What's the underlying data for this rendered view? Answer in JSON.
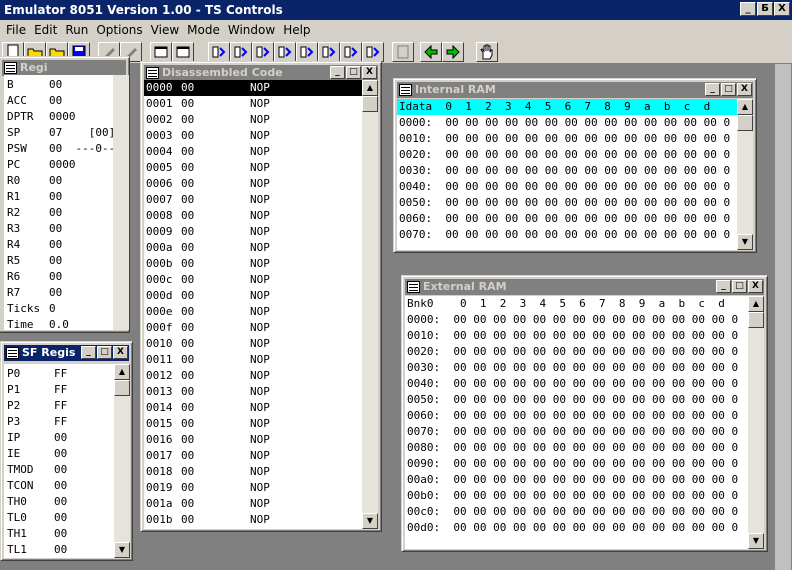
{
  "app": {
    "title": "Emulator 8051 Version 1.00 - TS Controls"
  },
  "menu": [
    "File",
    "Edit",
    "Run",
    "Options",
    "View",
    "Mode",
    "Window",
    "Help"
  ],
  "caption_buttons": [
    "_",
    "Б",
    "X"
  ],
  "toolbar_icons": [
    "new-file-icon",
    "open-folder-icon",
    "open-folder-icon",
    "save-icon",
    "tool-icon",
    "tool-icon",
    "window-icon",
    "window-icon",
    "step-icon",
    "step-icon",
    "step-icon",
    "step-icon",
    "step-icon",
    "step-icon",
    "step-icon",
    "step-icon",
    "disabled-icon",
    "back-arrow-icon",
    "forward-arrow-icon",
    "hand-icon"
  ],
  "registers": {
    "title": "Regi",
    "rows": [
      {
        "name": "B",
        "value": "00"
      },
      {
        "name": "ACC",
        "value": "00"
      },
      {
        "name": "DPTR",
        "value": "0000"
      },
      {
        "name": "SP",
        "value": "07    [00]"
      },
      {
        "name": "PSW",
        "value": "00  ---0--"
      },
      {
        "name": "PC",
        "value": "0000"
      },
      {
        "name": "R0",
        "value": "00"
      },
      {
        "name": "R1",
        "value": "00"
      },
      {
        "name": "R2",
        "value": "00"
      },
      {
        "name": "R3",
        "value": "00"
      },
      {
        "name": "R4",
        "value": "00"
      },
      {
        "name": "R5",
        "value": "00"
      },
      {
        "name": "R6",
        "value": "00"
      },
      {
        "name": "R7",
        "value": "00"
      },
      {
        "name": "Ticks",
        "value": "0"
      },
      {
        "name": "Time",
        "value": "0.0"
      }
    ]
  },
  "sfr": {
    "title": "SF Regis",
    "rows": [
      {
        "name": "P0",
        "value": "FF"
      },
      {
        "name": "P1",
        "value": "FF"
      },
      {
        "name": "P2",
        "value": "FF"
      },
      {
        "name": "P3",
        "value": "FF"
      },
      {
        "name": "IP",
        "value": "00"
      },
      {
        "name": "IE",
        "value": "00"
      },
      {
        "name": "TMOD",
        "value": "00"
      },
      {
        "name": "TCON",
        "value": "00"
      },
      {
        "name": "TH0",
        "value": "00"
      },
      {
        "name": "TL0",
        "value": "00"
      },
      {
        "name": "TH1",
        "value": "00"
      },
      {
        "name": "TL1",
        "value": "00"
      }
    ]
  },
  "disasm": {
    "title": "Disassembled Code",
    "rows": [
      {
        "addr": "0000",
        "byte": "00",
        "op": "NOP"
      },
      {
        "addr": "0001",
        "byte": "00",
        "op": "NOP"
      },
      {
        "addr": "0002",
        "byte": "00",
        "op": "NOP"
      },
      {
        "addr": "0003",
        "byte": "00",
        "op": "NOP"
      },
      {
        "addr": "0004",
        "byte": "00",
        "op": "NOP"
      },
      {
        "addr": "0005",
        "byte": "00",
        "op": "NOP"
      },
      {
        "addr": "0006",
        "byte": "00",
        "op": "NOP"
      },
      {
        "addr": "0007",
        "byte": "00",
        "op": "NOP"
      },
      {
        "addr": "0008",
        "byte": "00",
        "op": "NOP"
      },
      {
        "addr": "0009",
        "byte": "00",
        "op": "NOP"
      },
      {
        "addr": "000a",
        "byte": "00",
        "op": "NOP"
      },
      {
        "addr": "000b",
        "byte": "00",
        "op": "NOP"
      },
      {
        "addr": "000c",
        "byte": "00",
        "op": "NOP"
      },
      {
        "addr": "000d",
        "byte": "00",
        "op": "NOP"
      },
      {
        "addr": "000e",
        "byte": "00",
        "op": "NOP"
      },
      {
        "addr": "000f",
        "byte": "00",
        "op": "NOP"
      },
      {
        "addr": "0010",
        "byte": "00",
        "op": "NOP"
      },
      {
        "addr": "0011",
        "byte": "00",
        "op": "NOP"
      },
      {
        "addr": "0012",
        "byte": "00",
        "op": "NOP"
      },
      {
        "addr": "0013",
        "byte": "00",
        "op": "NOP"
      },
      {
        "addr": "0014",
        "byte": "00",
        "op": "NOP"
      },
      {
        "addr": "0015",
        "byte": "00",
        "op": "NOP"
      },
      {
        "addr": "0016",
        "byte": "00",
        "op": "NOP"
      },
      {
        "addr": "0017",
        "byte": "00",
        "op": "NOP"
      },
      {
        "addr": "0018",
        "byte": "00",
        "op": "NOP"
      },
      {
        "addr": "0019",
        "byte": "00",
        "op": "NOP"
      },
      {
        "addr": "001a",
        "byte": "00",
        "op": "NOP"
      },
      {
        "addr": "001b",
        "byte": "00",
        "op": "NOP"
      }
    ]
  },
  "iram": {
    "title": "Internal RAM",
    "header": "Idata  0  1  2  3  4  5  6  7  8  9  a  b  c  d",
    "rows": [
      "0000:  00 00 00 00 00 00 00 00 00 00 00 00 00 00 0",
      "0010:  00 00 00 00 00 00 00 00 00 00 00 00 00 00 0",
      "0020:  00 00 00 00 00 00 00 00 00 00 00 00 00 00 0",
      "0030:  00 00 00 00 00 00 00 00 00 00 00 00 00 00 0",
      "0040:  00 00 00 00 00 00 00 00 00 00 00 00 00 00 0",
      "0050:  00 00 00 00 00 00 00 00 00 00 00 00 00 00 0",
      "0060:  00 00 00 00 00 00 00 00 00 00 00 00 00 00 0",
      "0070:  00 00 00 00 00 00 00 00 00 00 00 00 00 00 0"
    ]
  },
  "xram": {
    "title": "External RAM",
    "header": "Bnk0    0  1  2  3  4  5  6  7  8  9  a  b  c  d",
    "rows": [
      "0000:  00 00 00 00 00 00 00 00 00 00 00 00 00 00 0",
      "0010:  00 00 00 00 00 00 00 00 00 00 00 00 00 00 0",
      "0020:  00 00 00 00 00 00 00 00 00 00 00 00 00 00 0",
      "0030:  00 00 00 00 00 00 00 00 00 00 00 00 00 00 0",
      "0040:  00 00 00 00 00 00 00 00 00 00 00 00 00 00 0",
      "0050:  00 00 00 00 00 00 00 00 00 00 00 00 00 00 0",
      "0060:  00 00 00 00 00 00 00 00 00 00 00 00 00 00 0",
      "0070:  00 00 00 00 00 00 00 00 00 00 00 00 00 00 0",
      "0080:  00 00 00 00 00 00 00 00 00 00 00 00 00 00 0",
      "0090:  00 00 00 00 00 00 00 00 00 00 00 00 00 00 0",
      "00a0:  00 00 00 00 00 00 00 00 00 00 00 00 00 00 0",
      "00b0:  00 00 00 00 00 00 00 00 00 00 00 00 00 00 0",
      "00c0:  00 00 00 00 00 00 00 00 00 00 00 00 00 00 0",
      "00d0:  00 00 00 00 00 00 00 00 00 00 00 00 00 00 0"
    ]
  },
  "colors": {
    "title_active": "#0a246a",
    "title_inactive": "#808080",
    "header_cyan": "#00ffff",
    "face": "#d4d0c8",
    "desktop": "#808080"
  }
}
